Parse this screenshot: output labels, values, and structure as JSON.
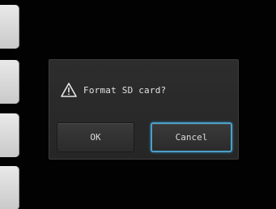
{
  "dialog": {
    "message": "Format SD card?",
    "icon": "warning-icon",
    "ok_label": "OK",
    "cancel_label": "Cancel",
    "focused_button": "cancel",
    "focus_color": "#4aa0c8"
  }
}
